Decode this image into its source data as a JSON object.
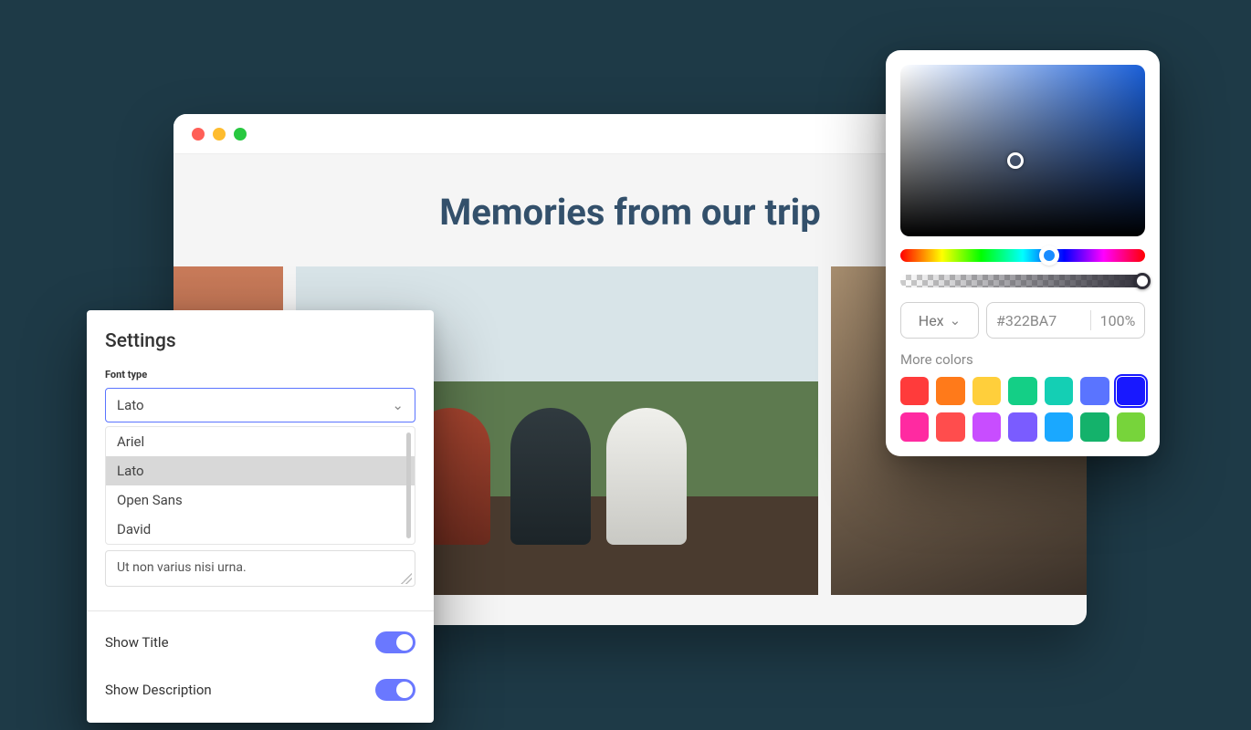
{
  "browser": {
    "page_title": "Memories from our trip"
  },
  "settings": {
    "title": "Settings",
    "font_type_label": "Font type",
    "font_selected": "Lato",
    "font_options": [
      "Ariel",
      "Lato",
      "Open Sans",
      "David"
    ],
    "description_value": "Ut non varius nisi urna.",
    "toggles": [
      {
        "label": "Show Title",
        "on": true
      },
      {
        "label": "Show Description",
        "on": true
      }
    ]
  },
  "colorpicker": {
    "mode": "Hex",
    "hex": "#322BA7",
    "opacity": "100%",
    "more_label": "More colors",
    "swatches": [
      "#ff3b3b",
      "#ff7a1a",
      "#ffcf3b",
      "#14cf86",
      "#14cfb4",
      "#5a74ff",
      "#1818ff",
      "#ff2aa1",
      "#ff4d4d",
      "#c84dff",
      "#7a5cff",
      "#1aa8ff",
      "#14b26b",
      "#77d43b"
    ],
    "selected_swatch_index": 6
  }
}
